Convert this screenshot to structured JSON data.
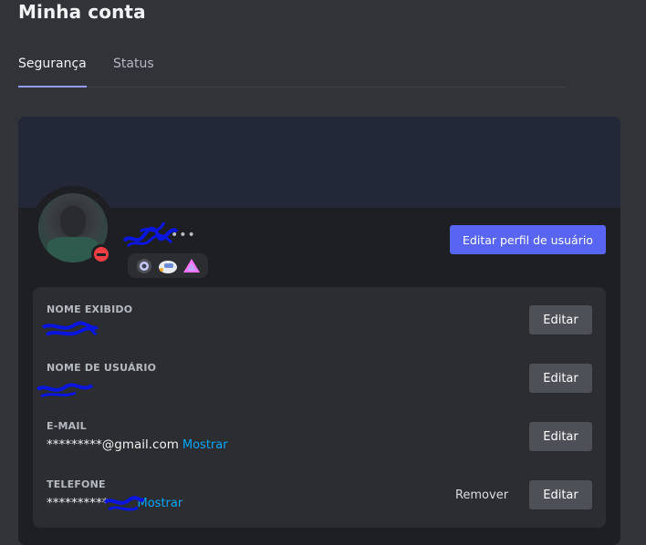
{
  "page": {
    "title": "Minha conta"
  },
  "tabs": [
    {
      "label": "Segurança",
      "active": true
    },
    {
      "label": "Status",
      "active": false
    }
  ],
  "profile": {
    "edit_profile_label": "Editar perfil de usuário",
    "more_label": "•••",
    "status": "do-not-disturb",
    "badges": [
      "hypesquad-badge",
      "quest-badge",
      "nitro-boost-badge"
    ]
  },
  "fields": [
    {
      "label": "NOME EXIBIDO",
      "value": "",
      "edit_label": "Editar"
    },
    {
      "label": "NOME DE USUÁRIO",
      "value": "",
      "edit_label": "Editar"
    },
    {
      "label": "E-MAIL",
      "value": "*********@gmail.com",
      "show_label": "Mostrar",
      "edit_label": "Editar"
    },
    {
      "label": "TELEFONE",
      "value": "**********",
      "show_label": "Mostrar",
      "remove_label": "Remover",
      "edit_label": "Editar"
    }
  ],
  "colors": {
    "background": "#313338",
    "card": "#1e1f22",
    "banner": "#232838",
    "accent": "#5865f2",
    "link": "#00a8fc",
    "dnd": "#f23f43"
  }
}
